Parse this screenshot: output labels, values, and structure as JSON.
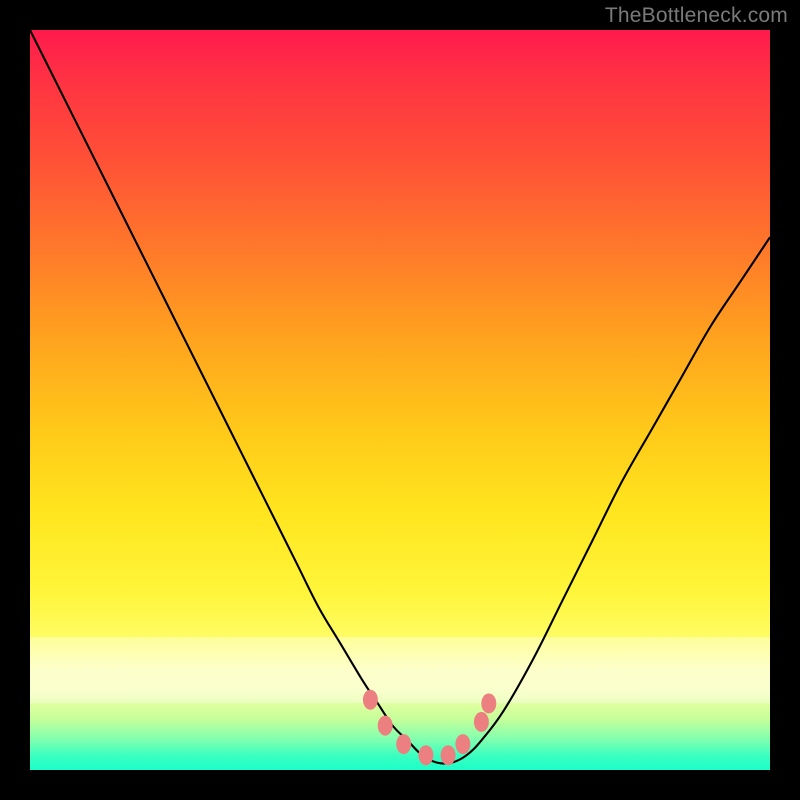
{
  "watermark": "TheBottleneck.com",
  "colors": {
    "frame_bg": "#000000",
    "curve_stroke": "#000000",
    "marker_fill": "#ec8080",
    "marker_stroke": "#d86f6f"
  },
  "chart_data": {
    "type": "line",
    "title": "",
    "xlabel": "",
    "ylabel": "",
    "xlim": [
      0,
      100
    ],
    "ylim": [
      0,
      100
    ],
    "grid": false,
    "legend": false,
    "x": [
      0,
      3,
      6,
      9,
      12,
      15,
      18,
      21,
      24,
      27,
      30,
      33,
      36,
      39,
      42,
      45,
      47,
      49,
      51,
      53,
      55,
      57,
      59,
      61,
      64,
      68,
      72,
      76,
      80,
      84,
      88,
      92,
      96,
      100
    ],
    "values": [
      100,
      94,
      88,
      82,
      76,
      70,
      64,
      58,
      52,
      46,
      40,
      34,
      28,
      22,
      17,
      12,
      9,
      6,
      4,
      2,
      1,
      1,
      2,
      4,
      8,
      15,
      23,
      31,
      39,
      46,
      53,
      60,
      66,
      72
    ],
    "markers": {
      "x": [
        46,
        48,
        50.5,
        53.5,
        56.5,
        58.5,
        61,
        62
      ],
      "y": [
        9.5,
        6,
        3.5,
        2,
        2,
        3.5,
        6.5,
        9
      ]
    },
    "note": "Values are percentage of plot height from bottom; chart has no numeric axes, values are geometric estimates of the rendered curve shape."
  }
}
